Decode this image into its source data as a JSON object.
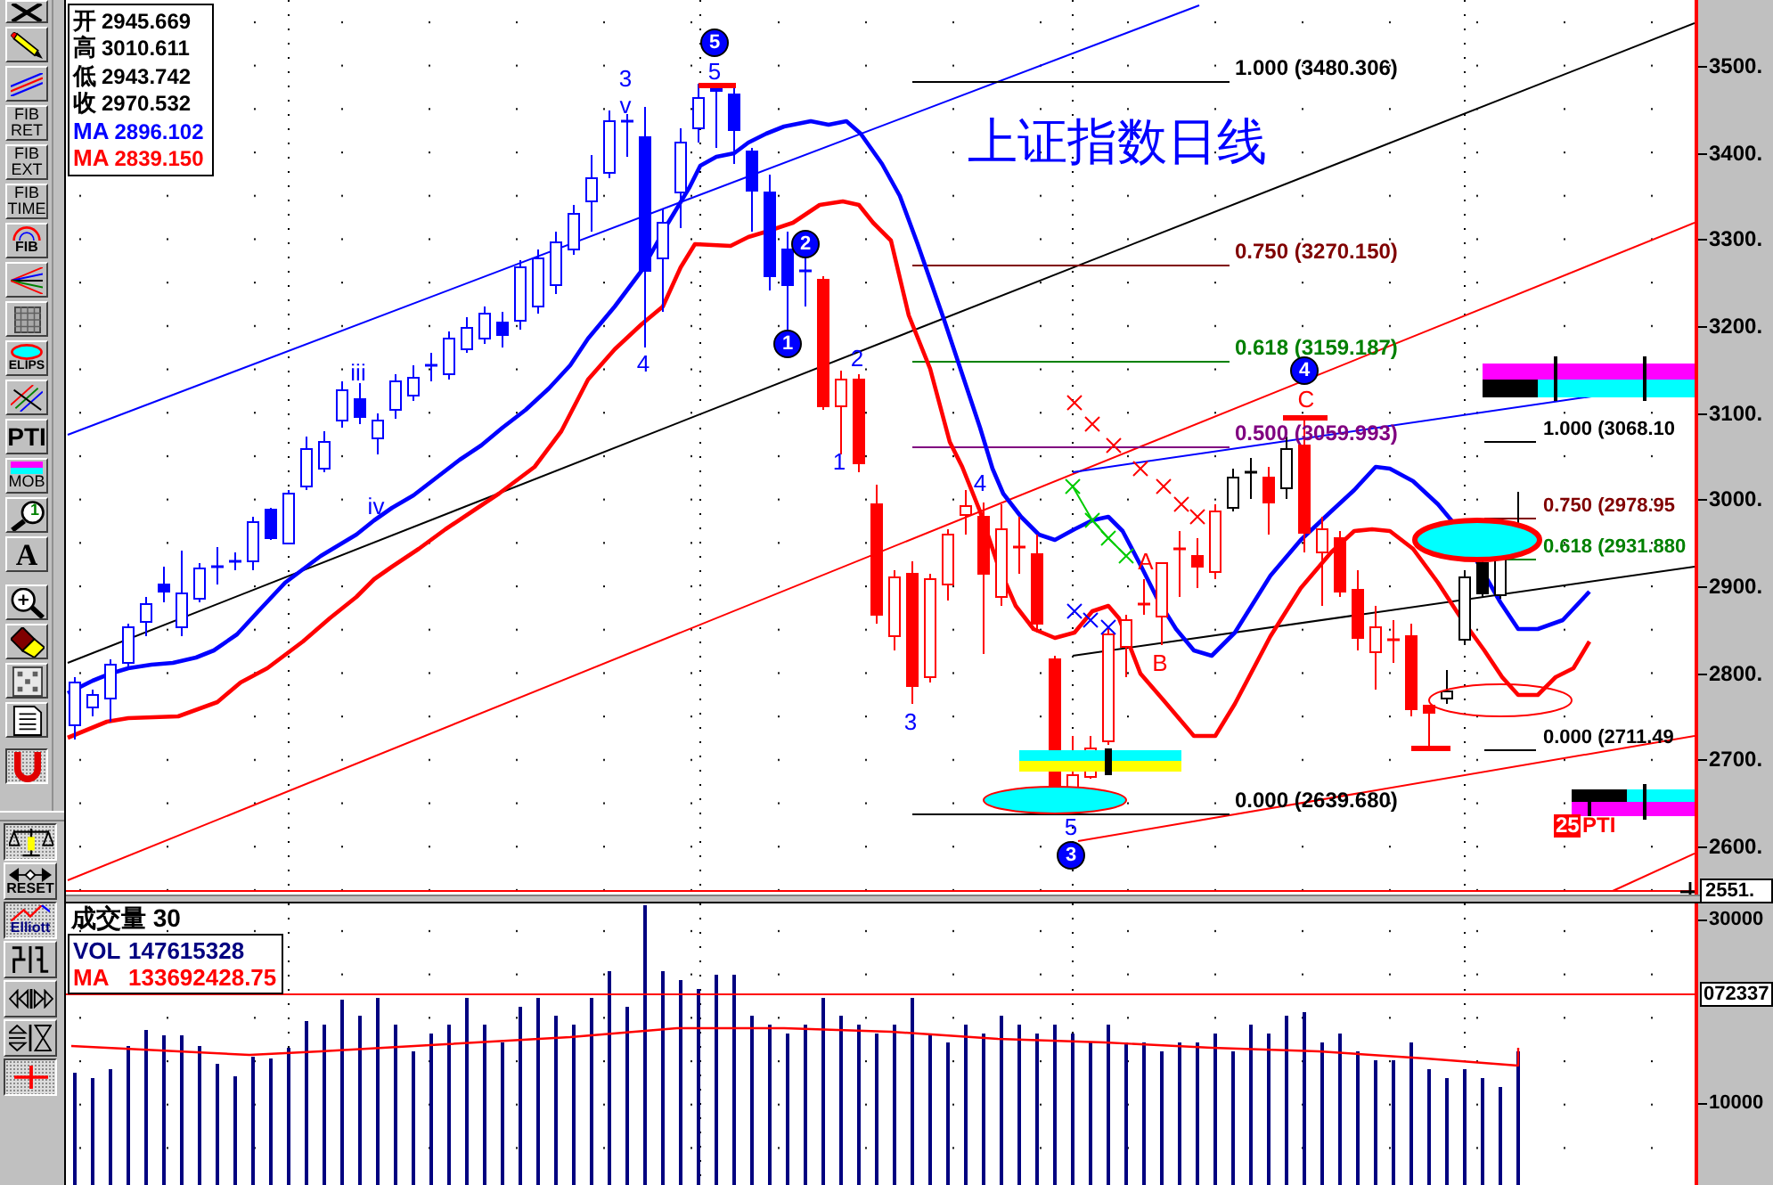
{
  "tool_groups": [
    {
      "tools": [
        {
          "kind": "pointer",
          "pressed": false
        }
      ]
    },
    {
      "tools": [
        {
          "kind": "pencil",
          "pressed": false
        },
        {
          "kind": "lines",
          "pressed": false
        },
        {
          "kind": "caption",
          "label": "FIB RET",
          "pressed": false
        },
        {
          "kind": "caption",
          "label": "FIB EXT",
          "pressed": false
        },
        {
          "kind": "caption",
          "label": "FIB TIME",
          "pressed": false
        },
        {
          "kind": "arc",
          "label": "FIB",
          "pressed": false
        },
        {
          "kind": "fan",
          "pressed": false
        },
        {
          "kind": "grid",
          "pressed": false
        },
        {
          "kind": "ellipse",
          "label": "ELIPS",
          "pressed": false
        },
        {
          "kind": "parallel",
          "pressed": false
        },
        {
          "kind": "heavy",
          "label": "PTI",
          "pressed": false
        },
        {
          "kind": "bars",
          "label": "MOB",
          "pressed": false
        },
        {
          "kind": "magnifier",
          "label": "1",
          "pressed": false
        },
        {
          "kind": "letter",
          "label": "A",
          "pressed": false
        }
      ]
    },
    {
      "tools": [
        {
          "kind": "zoom",
          "pressed": false
        },
        {
          "kind": "eraser",
          "pressed": false
        },
        {
          "kind": "squares",
          "pressed": false
        },
        {
          "kind": "document",
          "pressed": false
        }
      ]
    },
    {
      "tools": [
        {
          "kind": "magnet",
          "pressed": true
        }
      ]
    }
  ],
  "lower_tools": [
    {
      "kind": "balance",
      "pressed": true
    },
    {
      "kind": "reset",
      "label": "RESET",
      "pressed": false
    },
    {
      "kind": "elliott",
      "label": "Elliott",
      "pressed": true
    },
    {
      "kind": "steps",
      "pressed": false
    },
    {
      "kind": "hflip",
      "pressed": false
    },
    {
      "kind": "vflip",
      "pressed": false
    },
    {
      "kind": "crosshair",
      "pressed": true
    }
  ],
  "price_panel": {
    "info_box": [
      {
        "label": "开",
        "value": "2945.669",
        "color": "#000000"
      },
      {
        "label": "高",
        "value": "3010.611",
        "color": "#000000"
      },
      {
        "label": "低",
        "value": "2943.742",
        "color": "#000000"
      },
      {
        "label": "收",
        "value": "2970.532",
        "color": "#000000"
      },
      {
        "label": "MA",
        "value": "2896.102",
        "color": "#0000ff"
      },
      {
        "label": "MA",
        "value": "2839.150",
        "color": "#ff0000"
      }
    ],
    "title": "上证指数日线",
    "fib_retracement": [
      {
        "label": "1.000 (3480.306)",
        "color": "#000000"
      },
      {
        "label": "0.750 (3270.150)",
        "color": "#800000"
      },
      {
        "label": "0.618 (3159.187)",
        "color": "#008000"
      },
      {
        "label": "0.500 (3059.993)",
        "color": "#800080"
      },
      {
        "label": "0.000 (2639.680)",
        "color": "#000000"
      }
    ],
    "fib_projection": [
      {
        "label": "1.000 (3068.10",
        "color": "#000000"
      },
      {
        "label": "0.750 (2978.95",
        "color": "#800000"
      },
      {
        "label": "0.618 (2931.880",
        "color": "#008000"
      },
      {
        "label": "0.000 (2711.49",
        "color": "#000000"
      }
    ],
    "wave_labels": [
      {
        "text": "5",
        "kind": "circled",
        "color": "#0000ff"
      },
      {
        "text": "3",
        "kind": "plain",
        "color": "#0000ff"
      },
      {
        "text": "5",
        "kind": "plain",
        "color": "#0000ff"
      },
      {
        "text": "v",
        "kind": "plain",
        "color": "#0000ff"
      },
      {
        "text": "2",
        "kind": "circled",
        "color": "#0000ff"
      },
      {
        "text": "1",
        "kind": "circled",
        "color": "#0000ff"
      },
      {
        "text": "4",
        "kind": "plain",
        "color": "#0000ff"
      },
      {
        "text": "2",
        "kind": "plain",
        "color": "#0000ff"
      },
      {
        "text": "iii",
        "kind": "plain",
        "color": "#0000ff"
      },
      {
        "text": "4",
        "kind": "circled",
        "color": "#0000ff"
      },
      {
        "text": "C",
        "kind": "plain",
        "color": "#ff0000"
      },
      {
        "text": "1",
        "kind": "plain",
        "color": "#0000ff"
      },
      {
        "text": "4",
        "kind": "plain",
        "color": "#0000ff"
      },
      {
        "text": "iv",
        "kind": "plain",
        "color": "#0000ff"
      },
      {
        "text": "A",
        "kind": "plain",
        "color": "#ff0000"
      },
      {
        "text": "B",
        "kind": "plain",
        "color": "#ff0000"
      },
      {
        "text": "3",
        "kind": "plain",
        "color": "#0000ff"
      },
      {
        "text": "5",
        "kind": "plain",
        "color": "#0000ff"
      },
      {
        "text": "3",
        "kind": "circled",
        "color": "#0000ff"
      }
    ],
    "pti_label": {
      "number": "25",
      "text": "PTI"
    },
    "axis_labels": [
      "3500.",
      "3400.",
      "3300.",
      "3200.",
      "3100.",
      "3000.",
      "2900.",
      "2800.",
      "2700.",
      "2600."
    ],
    "cursor_value": "2551."
  },
  "volume_panel": {
    "title": "成交量 30",
    "legend": [
      {
        "label": "VOL",
        "value": "147615328",
        "color": "#000080"
      },
      {
        "label": "MA",
        "value": "133692428.75",
        "color": "#ff0000"
      }
    ],
    "axis_labels": [
      "30000",
      "10000"
    ],
    "line_value": "072337"
  }
}
